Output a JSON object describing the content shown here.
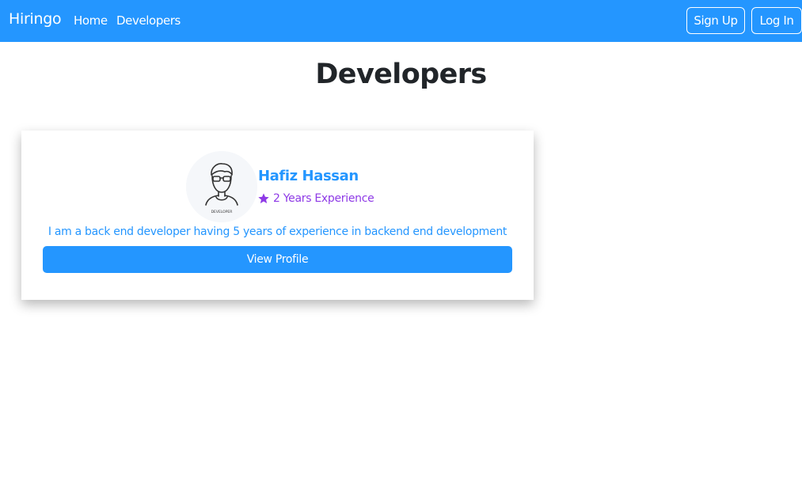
{
  "navbar": {
    "brand": "Hiringo",
    "links": [
      "Home",
      "Developers"
    ],
    "signup_label": "Sign Up",
    "login_label": "Log In",
    "color": "#2496ff"
  },
  "page": {
    "title": "Developers"
  },
  "developers": [
    {
      "avatar_caption": "DEVELOPER",
      "name": "Hafiz Hassan",
      "experience": "2 Years Experience",
      "bio": "I am a back end developer having 5 years of experience in backend end development",
      "button_label": "View Profile",
      "experience_icon": "star-icon",
      "experience_color": "#8e3ae6"
    }
  ]
}
